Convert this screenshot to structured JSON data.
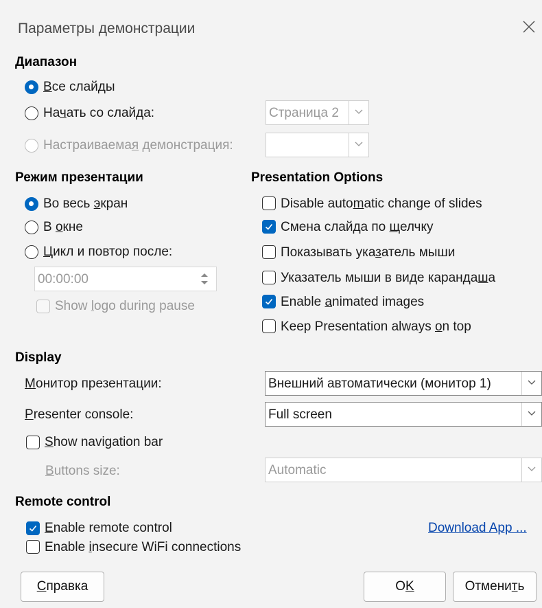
{
  "window": {
    "title": "Параметры демонстрации"
  },
  "range": {
    "heading": "Диапазон",
    "all_slides": {
      "pre": "",
      "mn": "В",
      "post": "се слайды",
      "selected": true
    },
    "start_from": {
      "pre": "На",
      "mn": "ч",
      "post": "ать со слайда:",
      "selected": false
    },
    "start_value": "Страница 2",
    "custom": {
      "pre": "Настраиваема",
      "mn": "я",
      "post": " демонстрация:",
      "selected": false,
      "enabled": false
    },
    "custom_value": ""
  },
  "mode": {
    "heading": "Режим презентации",
    "fullscreen": {
      "pre": "Во весь ",
      "mn": "э",
      "post": "кран",
      "selected": true
    },
    "window": {
      "pre": "В ",
      "mn": "о",
      "post": "кне",
      "selected": false
    },
    "loop": {
      "pre": "",
      "mn": "Ц",
      "post": "икл и повтор после:",
      "selected": false
    },
    "loop_time": "00:00:00",
    "show_logo": {
      "pre": "Show ",
      "mn": "l",
      "post": "ogo during pause",
      "checked": false,
      "enabled": false
    }
  },
  "options": {
    "heading": "Presentation Options",
    "items": [
      {
        "pre": "Disable auto",
        "mn": "m",
        "post": "atic change of slides",
        "checked": false
      },
      {
        "pre": "Смена слайда по ",
        "mn": "щ",
        "post": "елчку",
        "checked": true
      },
      {
        "pre": "Показывать ука",
        "mn": "з",
        "post": "атель мыши",
        "checked": false
      },
      {
        "pre": "Указатель мыши в виде каранда",
        "mn": "ш",
        "post": "а",
        "checked": false
      },
      {
        "pre": "Enable ",
        "mn": "a",
        "post": "nimated images",
        "checked": true
      },
      {
        "pre": "Keep Presentation always ",
        "mn": "o",
        "post": "n top",
        "checked": false
      }
    ]
  },
  "display": {
    "heading": "Display",
    "monitor_label": {
      "pre": "",
      "mn": "М",
      "post": "онитор презентации:"
    },
    "monitor_value": "Внешний автоматически (монитор 1)",
    "console_label": {
      "pre": "",
      "mn": "P",
      "post": "resenter console:"
    },
    "console_value": "Full screen",
    "navbar": {
      "pre": "",
      "mn": "S",
      "post": "how navigation bar",
      "checked": false
    },
    "buttons_size_label": {
      "pre": "",
      "mn": "B",
      "post": "uttons size:"
    },
    "buttons_size_value": "Automatic"
  },
  "remote": {
    "heading": "Remote control",
    "enable": {
      "pre": "",
      "mn": "E",
      "post": "nable remote control",
      "checked": true
    },
    "insecure": {
      "pre": "Enable ",
      "mn": "i",
      "post": "nsecure WiFi connections",
      "checked": false
    },
    "download_link": "Download App ..."
  },
  "buttons": {
    "help": {
      "pre": "",
      "mn": "С",
      "post": "правка"
    },
    "ok": {
      "pre": "O",
      "mn": "K",
      "post": ""
    },
    "cancel": {
      "pre": "Отмени",
      "mn": "т",
      "post": "ь"
    }
  },
  "colors": {
    "accent": "#0067c0",
    "link": "#0645ad",
    "disabled": "#9a9a9a",
    "background": "#f3f3f3"
  },
  "icons": {
    "close": "close-icon",
    "chevron": "chevron-down-icon",
    "spin": "spin-arrows-icon",
    "check": "check-icon"
  }
}
